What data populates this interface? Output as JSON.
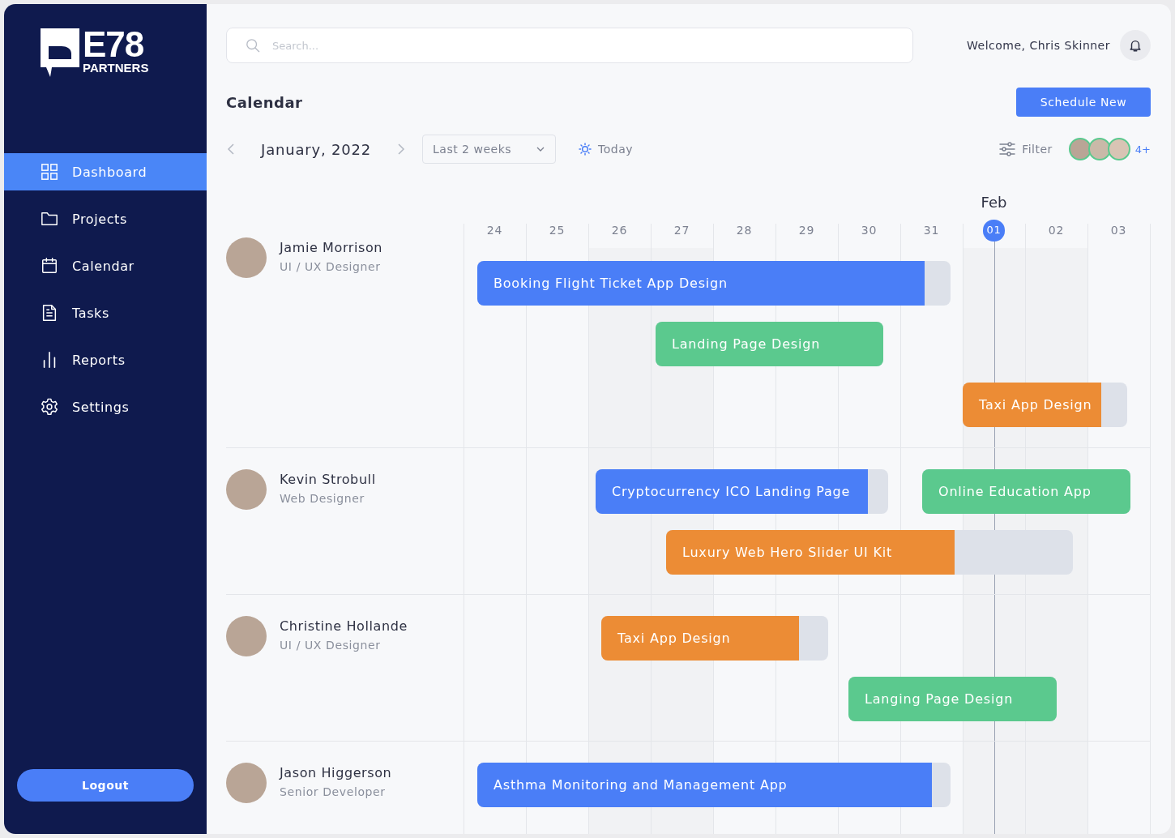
{
  "sidebar": {
    "logo": {
      "name": "E78",
      "tagline": "PARTNERS"
    },
    "items": [
      {
        "label": "Dashboard",
        "kind": "dashboard",
        "selected": true
      },
      {
        "label": "Projects",
        "kind": "folder",
        "selected": false
      },
      {
        "label": "Calendar",
        "kind": "calendar",
        "selected": false
      },
      {
        "label": "Tasks",
        "kind": "document",
        "selected": false
      },
      {
        "label": "Reports",
        "kind": "chart",
        "selected": false
      },
      {
        "label": "Settings",
        "kind": "gear",
        "selected": false
      }
    ],
    "logout": "Logout"
  },
  "header": {
    "search": {
      "placeholder": "Search..."
    },
    "welcome": "Welcome, Chris Skinner"
  },
  "page": {
    "title": "Calendar",
    "primary_button": "Schedule New"
  },
  "toolbar": {
    "month": "January, 2022",
    "range": "Last 2 weeks",
    "today": "Today",
    "filter": "Filter",
    "more_members": "4+"
  },
  "timeline": {
    "month_marker": "Feb",
    "days": [
      {
        "label": "24",
        "selected": false
      },
      {
        "label": "25",
        "selected": false
      },
      {
        "label": "26",
        "selected": false
      },
      {
        "label": "27",
        "selected": false
      },
      {
        "label": "28",
        "selected": false
      },
      {
        "label": "29",
        "selected": false
      },
      {
        "label": "30",
        "selected": false
      },
      {
        "label": "31",
        "selected": false
      },
      {
        "label": "01",
        "selected": true
      },
      {
        "label": "02",
        "selected": false
      },
      {
        "label": "03",
        "selected": false
      }
    ]
  },
  "people": [
    {
      "name": "Jamie Morrison",
      "role": "UI / UX Designer",
      "tasks": [
        {
          "title": "Booking Flight Ticket App Design",
          "color": "#4a7ef7",
          "level": 0.945
        },
        {
          "title": "Landing Page Design",
          "color": "#5bc98e",
          "level": 1
        },
        {
          "title": "Taxi App Design",
          "color": "#ec8c35",
          "level": 0.84
        }
      ]
    },
    {
      "name": "Kevin Strobull",
      "role": "Web Designer",
      "tasks": [
        {
          "title": "Cryptocurrency ICO Landing Page",
          "color": "#4a7ef7",
          "level": 0.93
        },
        {
          "title": "Online Education App",
          "color": "#5bc98e",
          "level": 1
        },
        {
          "title": "Luxury Web Hero Slider UI Kit",
          "color": "#ec8c35",
          "level": 0.71
        }
      ]
    },
    {
      "name": "Christine Hollande",
      "role": "UI / UX Designer",
      "tasks": [
        {
          "title": "Taxi App Design",
          "color": "#ec8c35",
          "level": 0.87
        },
        {
          "title": "Langing Page Design",
          "color": "#5bc98e",
          "level": 1
        }
      ]
    },
    {
      "name": "Jason Higgerson",
      "role": "Senior Developer",
      "tasks": [
        {
          "title": "Asthma Monitoring and Management App",
          "color": "#4a7ef7",
          "level": 0.96
        }
      ]
    }
  ]
}
